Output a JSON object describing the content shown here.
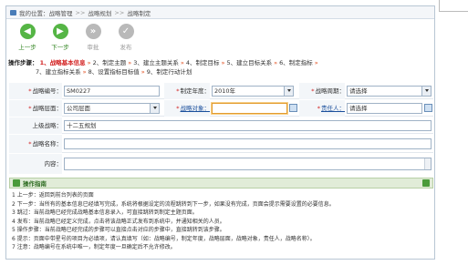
{
  "breadcrumb": [
    "我的位置：战略管理",
    "战略规划",
    "战略制定"
  ],
  "toolbar": {
    "prev": "上一步",
    "next": "下一步",
    "approve": "审批",
    "send": "发布"
  },
  "steps": {
    "head": "操作步骤：",
    "items": [
      "1、战略基本信息",
      "2、制定主题",
      "3、建立主题关系",
      "4、制定目标",
      "5、建立目标关系",
      "6、制定指标",
      "7、建立指标关系",
      "8、设置指标目标值",
      "9、制定行动计划"
    ]
  },
  "form": {
    "code_label": "战略编号：",
    "code_value": "SM0227",
    "year_label": "制定年度：",
    "year_value": "2010年",
    "period_label": "战略周期：",
    "period_value": "请选择",
    "level_label": "战略层面：",
    "level_value": "公司层面",
    "object_label": "战略对象：",
    "object_value": "",
    "owner_label": "责任人：",
    "owner_value": "请选择",
    "upper_label": "上级战略：",
    "upper_value": "十二五规划",
    "name_label": "战略名称：",
    "name_value": "",
    "content_label": "内容："
  },
  "guide": {
    "title": "操作指南"
  },
  "notes": [
    "1 上一步：返回到前台列表的页面",
    "2 下一步：当所有的基本信息已经填写完成，系统将根据设定的流程跳转到下一步，如果没有完成，页面会提示需要设置的必要信息。",
    "3 跳过：当前战略已经完成战略基本信息录入，可直接跳转到制定主题页面。",
    "4 发布：当前战略已经定义完成，点击将该战略正式发布到系统中，并通知相关的人员。",
    "5 操作步骤：当前战略已经完成的步骤可以直接点击对应的步骤中，直接跳转到该步骤。",
    "6 提示：页面中带星号的项目为必填项，请认真填写（如：战略编号，制定年度，战略层面，战略对象，责任人，战略名称）。",
    "7 注意：战略编号在系统中唯一，制定年度一旦确定后不允许修改。"
  ]
}
